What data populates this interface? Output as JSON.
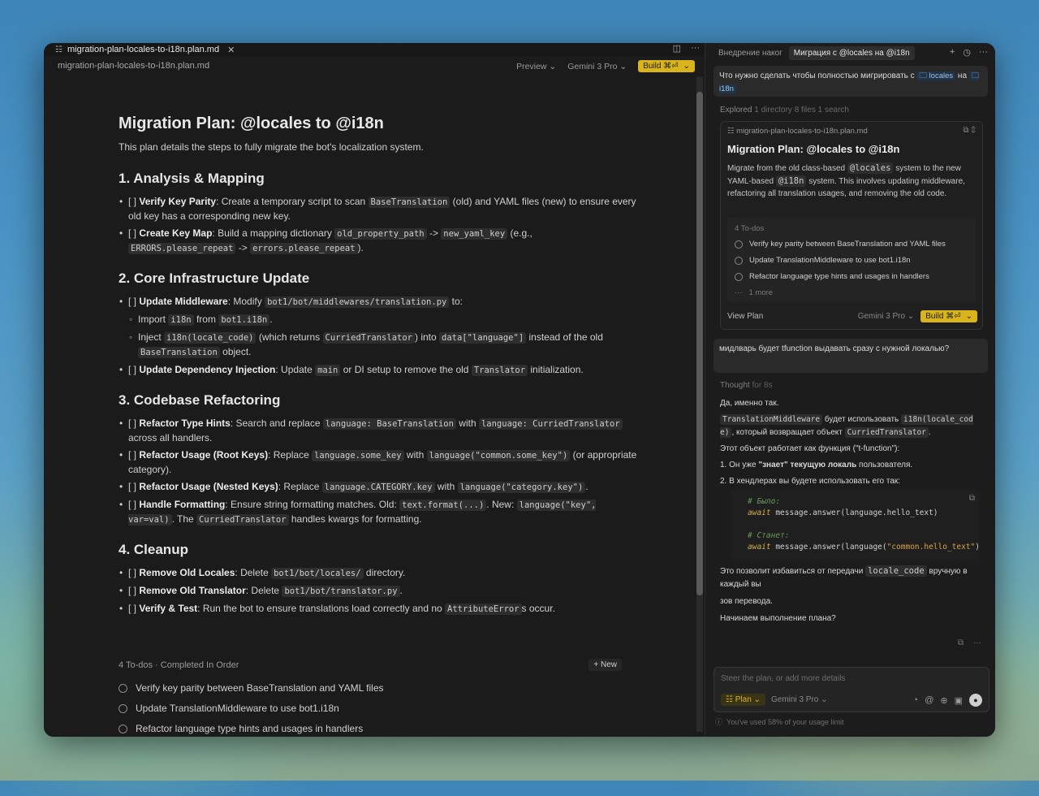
{
  "colors": {
    "accent": "#d9b41c",
    "bg": "#1b1b1b",
    "panel": "#1c1c1c"
  },
  "editor": {
    "tab_title": "migration-plan-locales-to-i18n.plan.md",
    "path": "migration-plan-locales-to-i18n.plan.md",
    "preview_label": "Preview ⌄",
    "model_label": "Gemini 3 Pro ⌄",
    "build_label": "Build ⌘⏎",
    "build_chevron": "⌄"
  },
  "doc": {
    "title": "Migration Plan: @locales to @i18n",
    "intro": "This plan details the steps to fully migrate the bot's localization system.",
    "s1": {
      "title": "1. Analysis & Mapping",
      "i1_head": "Verify Key Parity",
      "i1_a": ": Create a temporary script to scan ",
      "i1_code": "BaseTranslation",
      "i1_b": " (old) and YAML files (new) to ensure every old key has a corresponding new key.",
      "i2_head": "Create Key Map",
      "i2_a": ": Build a mapping dictionary ",
      "i2_code1": "old_property_path",
      "i2_b": " -> ",
      "i2_code2": "new_yaml_key",
      "i2_c": " (e.g., ",
      "i2_code3": "ERRORS.please_repeat",
      "i2_d": " -> ",
      "i2_code4": "errors.please_repeat",
      "i2_e": ")."
    },
    "s2": {
      "title": "2. Core Infrastructure Update",
      "i1_head": "Update Middleware",
      "i1_a": ": Modify ",
      "i1_code": "bot1/bot/middlewares/translation.py",
      "i1_b": " to:",
      "sub1_a": "Import ",
      "sub1_code1": "i18n",
      "sub1_b": " from ",
      "sub1_code2": "bot1.i18n",
      "sub1_c": ".",
      "sub2_a": "Inject ",
      "sub2_code1": "i18n(locale_code)",
      "sub2_b": " (which returns ",
      "sub2_code2": "CurriedTranslator",
      "sub2_c": ") into ",
      "sub2_code3": "data[\"language\"]",
      "sub2_d": " instead of the old ",
      "sub2_code4": "BaseTranslation",
      "sub2_e": " object.",
      "i2_head": "Update Dependency Injection",
      "i2_a": ": Update ",
      "i2_code1": "main",
      "i2_b": " or DI setup to remove the old ",
      "i2_code2": "Translator",
      "i2_c": " initialization."
    },
    "s3": {
      "title": "3. Codebase Refactoring",
      "i1_head": "Refactor Type Hints",
      "i1_a": ": Search and replace ",
      "i1_code1": "language: BaseTranslation",
      "i1_b": " with ",
      "i1_code2": "language: CurriedTranslator",
      "i1_c": " across all handlers.",
      "i2_head": "Refactor Usage (Root Keys)",
      "i2_a": ": Replace ",
      "i2_code1": "language.some_key",
      "i2_b": " with ",
      "i2_code2": "language(\"common.some_key\")",
      "i2_c": " (or appropriate category).",
      "i3_head": "Refactor Usage (Nested Keys)",
      "i3_a": ": Replace ",
      "i3_code1": "language.CATEGORY.key",
      "i3_b": " with ",
      "i3_code2": "language(\"category.key\")",
      "i3_c": ".",
      "i4_head": "Handle Formatting",
      "i4_a": ": Ensure string formatting matches. Old: ",
      "i4_code1": "text.format(...)",
      "i4_b": ". New: ",
      "i4_code2": "language(\"key\", var=val)",
      "i4_c": ". The ",
      "i4_code3": "CurriedTranslator",
      "i4_d": " handles kwargs for formatting."
    },
    "s4": {
      "title": "4. Cleanup",
      "i1_head": "Remove Old Locales",
      "i1_a": ": Delete ",
      "i1_code": "bot1/bot/locales/",
      "i1_b": " directory.",
      "i2_head": "Remove Old Translator",
      "i2_a": ": Delete ",
      "i2_code": "bot1/bot/translator.py",
      "i2_b": ".",
      "i3_head": "Verify & Test",
      "i3_a": ": Run the bot to ensure translations load correctly and no ",
      "i3_code": "AttributeError",
      "i3_b": "s occur."
    },
    "checkbox": "[ ]"
  },
  "todos": {
    "header": "4 To-dos · Completed In Order",
    "new_label": "+ New",
    "items": [
      "Verify key parity between BaseTranslation and YAML files",
      "Update TranslationMiddleware to use bot1.i18n",
      "Refactor language type hints and usages in handlers"
    ]
  },
  "chat": {
    "tab1": "Внедрение наког",
    "tab2": "Миграция с @locales на @i18n",
    "msg1_a": "Что нужно сделать чтобы полностью мигрировать с ",
    "msg1_chip1": "🗀 locales",
    "msg1_b": " на ",
    "msg1_chip2": "🗀 i18n",
    "explored": "Explored",
    "explored_detail": "1 directory 8 files 1 search",
    "card": {
      "fname": "migration-plan-locales-to-i18n.plan.md",
      "title": "Migration Plan: @locales to @i18n",
      "desc_a": "Migrate from the old class-based ",
      "desc_code1": "@locales",
      "desc_b": " system to the new YAML-based ",
      "desc_code2": "@i18n",
      "desc_c": " system. This involves updating middleware, refactoring all translation usages, and removing the old code.",
      "todo_count": "4 To-dos",
      "items": [
        "Verify key parity between BaseTranslation and YAML files",
        "Update TranslationMiddleware to use bot1.i18n",
        "Refactor language type hints and usages in handlers"
      ],
      "more": "1 more",
      "view_plan": "View Plan",
      "model": "Gemini 3 Pro ⌄",
      "build": "Build ⌘⏎"
    },
    "msg2": "мидлварь будет tfunction выдавать сразу с нужной локалью?",
    "thought": "Thought",
    "thought_time": "for 8s",
    "ans": {
      "p1": "Да, именно так.",
      "p2_code1": "TranslationMiddleware",
      "p2_a": " будет использовать ",
      "p2_code2": "i18n(locale_cod e)",
      "p2_b": ", который возвращает объект ",
      "p2_code3": "CurriedTranslator",
      "p2_c": ".",
      "p3": "Этот объект работает как функция (\"t-function\"):",
      "p4_a": "1. Он уже ",
      "p4_b": "\"знает\" текущую локаль",
      "p4_c": " пользователя.",
      "p5": "2. В хендлерах вы будете использовать его так:",
      "code_l1": "# Было:",
      "code_l2_kw": "await",
      "code_l2": " message.answer(language.hello_text)",
      "code_l3": "# Станет:",
      "code_l4_kw": "await",
      "code_l4_a": " message.answer(language(",
      "code_l4_str": "\"common.hello_text\"",
      "code_l4_b": "))",
      "p6_a": "Это позволит избавиться от передачи ",
      "p6_code": "locale_code",
      "p6_b": " вручную в каждый вы",
      "p7": "зов перевода.",
      "p8": "Начинаем выполнение плана?"
    },
    "composer_placeholder": "Steer the plan, or add more details",
    "plan_label": "Plan ⌄",
    "composer_model": "Gemini 3 Pro ⌄",
    "usage": "You've used 58% of your usage limit"
  }
}
